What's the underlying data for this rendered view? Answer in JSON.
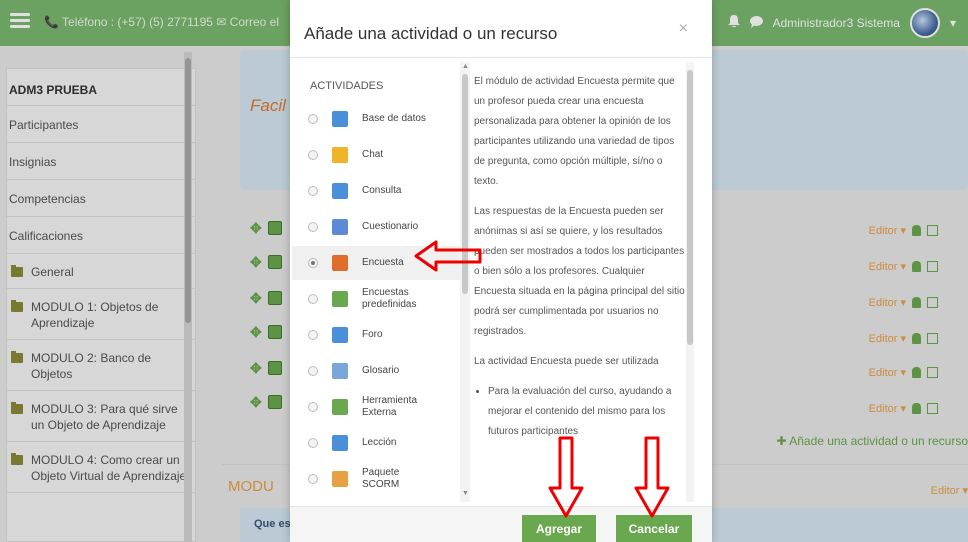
{
  "navbar": {
    "contact": "📞 Teléfono : (+57) (5) 2771195 ✉ Correo el",
    "user_name": "Administrador3 Sistema",
    "user_caret": "▾"
  },
  "sidebar": {
    "course": "ADM3 PRUEBA",
    "items": [
      "Participantes",
      "Insignias",
      "Competencias",
      "Calificaciones"
    ],
    "folders": [
      "General",
      "MODULO 1: Objetos de Aprendizaje",
      "MODULO 2: Banco de Objetos",
      "MODULO 3: Para qué sirve un Objeto de Aprendizaje",
      "MODULO 4: Como crear un Objeto Virtual de Aprendizaje"
    ]
  },
  "main": {
    "banner_text": "Facil",
    "editor_label": "Editor ▾",
    "add_activity": "✚ Añade una actividad o un recurso",
    "section_title": "MODU",
    "editor_bottom": "Editor ▾",
    "que_title": "Que es"
  },
  "modal": {
    "title": "Añade una actividad o un recurso",
    "close": "×",
    "list_heading": "ACTIVIDADES",
    "activities": [
      {
        "label": "Base de datos",
        "icon": "database-icon",
        "color": "#4a90d9"
      },
      {
        "label": "Chat",
        "icon": "chat-icon",
        "color": "#f0b429"
      },
      {
        "label": "Consulta",
        "icon": "question-icon",
        "color": "#4a90d9"
      },
      {
        "label": "Cuestionario",
        "icon": "quiz-icon",
        "color": "#5c8ad6"
      },
      {
        "label": "Encuesta",
        "icon": "megaphone-icon",
        "color": "#e06c2a"
      },
      {
        "label": "Encuestas predefinidas",
        "icon": "bar-chart-icon",
        "color": "#6aa84f"
      },
      {
        "label": "Foro",
        "icon": "forum-icon",
        "color": "#4a90d9"
      },
      {
        "label": "Glosario",
        "icon": "glossary-icon",
        "color": "#7aa7d9"
      },
      {
        "label": "Herramienta Externa",
        "icon": "puzzle-icon",
        "color": "#6aa84f"
      },
      {
        "label": "Lección",
        "icon": "lesson-icon",
        "color": "#4a90d9"
      },
      {
        "label": "Paquete SCORM",
        "icon": "package-icon",
        "color": "#e8a045"
      }
    ],
    "selected_index": 4,
    "description": {
      "p1": "El módulo de actividad Encuesta permite que un profesor pueda crear una encuesta personalizada para obtener la opinión de los participantes utilizando una variedad de tipos de pregunta, como opción múltiple, sí/no o texto.",
      "p2": "Las respuestas de la Encuesta pueden ser anónimas si así se quiere, y los resultados pueden ser mostrados a todos los participantes o bien sólo a los profesores. Cualquier Encuesta situada en la página principal del sitio podrá ser cumplimentada por usuarios no registrados.",
      "p3": "La actividad Encuesta puede ser utilizada",
      "bullet1": "Para la evaluación del curso, ayudando a mejorar el contenido del mismo para los futuros participantes"
    },
    "add_button": "Agregar",
    "cancel_button": "Cancelar"
  }
}
